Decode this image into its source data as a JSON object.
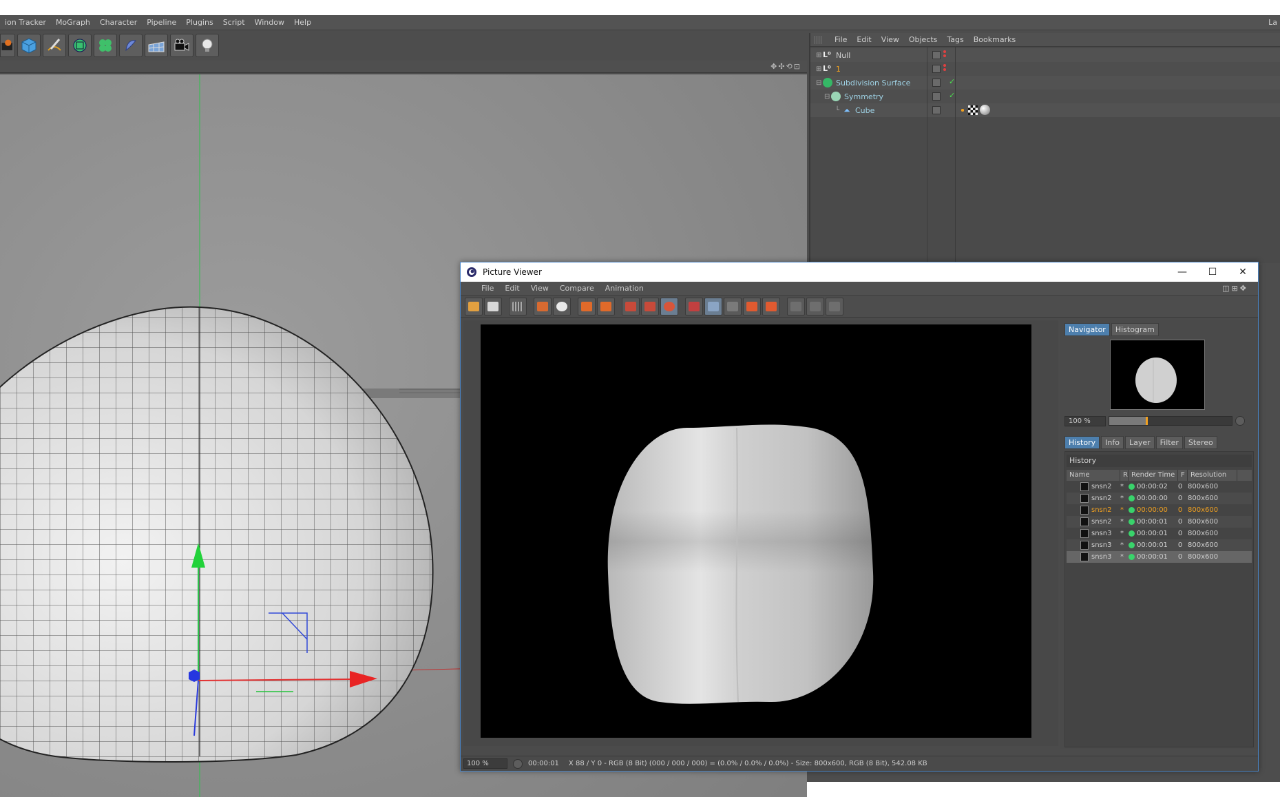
{
  "menubar": {
    "items": [
      "ion Tracker",
      "MoGraph",
      "Character",
      "Pipeline",
      "Plugins",
      "Script",
      "Window",
      "Help"
    ],
    "right_text": "La"
  },
  "object_manager": {
    "menu": [
      "File",
      "Edit",
      "View",
      "Objects",
      "Tags",
      "Bookmarks"
    ],
    "objects": [
      {
        "name": "Null",
        "color": "default"
      },
      {
        "name": "1",
        "color": "orange"
      },
      {
        "name": "Subdivision Surface",
        "color": "cyan"
      },
      {
        "name": "Symmetry",
        "color": "cyan"
      },
      {
        "name": "Cube",
        "color": "cyan"
      }
    ]
  },
  "picture_viewer": {
    "title": "Picture Viewer",
    "menu": [
      "File",
      "Edit",
      "View",
      "Compare",
      "Animation"
    ],
    "side_tabs_top": [
      "Navigator",
      "Histogram"
    ],
    "zoom": "100 %",
    "zoom_level": 0.3,
    "side_tabs_bottom": [
      "History",
      "Info",
      "Layer",
      "Filter",
      "Stereo"
    ],
    "history_title": "History",
    "history_columns": [
      "Name",
      "R",
      "Render Time",
      "F",
      "Resolution"
    ],
    "history_rows": [
      {
        "name": "snsn2",
        "flag": "*",
        "time": "00:00:02",
        "frame": "0",
        "res": "800x600",
        "style": "normal"
      },
      {
        "name": "snsn2",
        "flag": "*",
        "time": "00:00:00",
        "frame": "0",
        "res": "800x600",
        "style": "alt"
      },
      {
        "name": "snsn2",
        "flag": "*",
        "time": "00:00:00",
        "frame": "0",
        "res": "800x600",
        "style": "orange"
      },
      {
        "name": "snsn2",
        "flag": "*",
        "time": "00:00:01",
        "frame": "0",
        "res": "800x600",
        "style": "alt"
      },
      {
        "name": "snsn3",
        "flag": "*",
        "time": "00:00:01",
        "frame": "0",
        "res": "800x600",
        "style": "normal"
      },
      {
        "name": "snsn3",
        "flag": "*",
        "time": "00:00:01",
        "frame": "0",
        "res": "800x600",
        "style": "alt"
      },
      {
        "name": "snsn3",
        "flag": "*",
        "time": "00:00:01",
        "frame": "0",
        "res": "800x600",
        "style": "selected"
      }
    ],
    "status": {
      "zoom": "100 %",
      "time": "00:00:01",
      "info": "X 88 / Y 0 - RGB (8 Bit) (000 / 000 / 000) = (0.0% / 0.0% / 0.0%) - Size: 800x600, RGB (8 Bit), 542.08 KB"
    }
  }
}
